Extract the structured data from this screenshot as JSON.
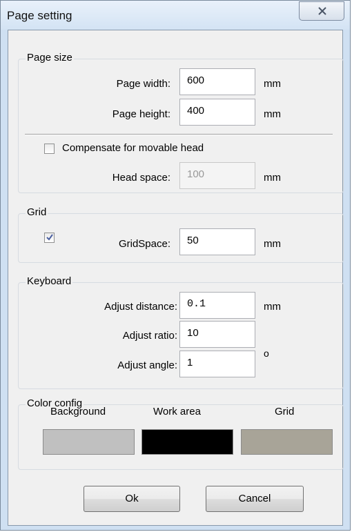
{
  "window": {
    "title": "Page setting"
  },
  "page_size": {
    "legend": "Page size",
    "width_label": "Page width:",
    "width_value": "600",
    "width_unit": "mm",
    "height_label": "Page height:",
    "height_value": "400",
    "height_unit": "mm",
    "compensate_label": "Compensate for movable head",
    "compensate_checked": false,
    "head_space_label": "Head space:",
    "head_space_value": "100",
    "head_space_unit": "mm"
  },
  "grid": {
    "legend": "Grid",
    "enabled_checked": true,
    "space_label": "GridSpace:",
    "space_value": "50",
    "space_unit": "mm"
  },
  "keyboard": {
    "legend": "Keyboard",
    "distance_label": "Adjust distance:",
    "distance_value": "0.1",
    "distance_unit": "mm",
    "ratio_label": "Adjust ratio:",
    "ratio_value": "10",
    "angle_label": "Adjust angle:",
    "angle_value": "1",
    "angle_unit": "o"
  },
  "color_config": {
    "legend": "Color config",
    "background_label": "Background",
    "background_color": "#c0c0c0",
    "work_area_label": "Work area",
    "work_area_color": "#000000",
    "grid_label": "Grid",
    "grid_color": "#a8a498"
  },
  "buttons": {
    "ok": "Ok",
    "cancel": "Cancel"
  }
}
